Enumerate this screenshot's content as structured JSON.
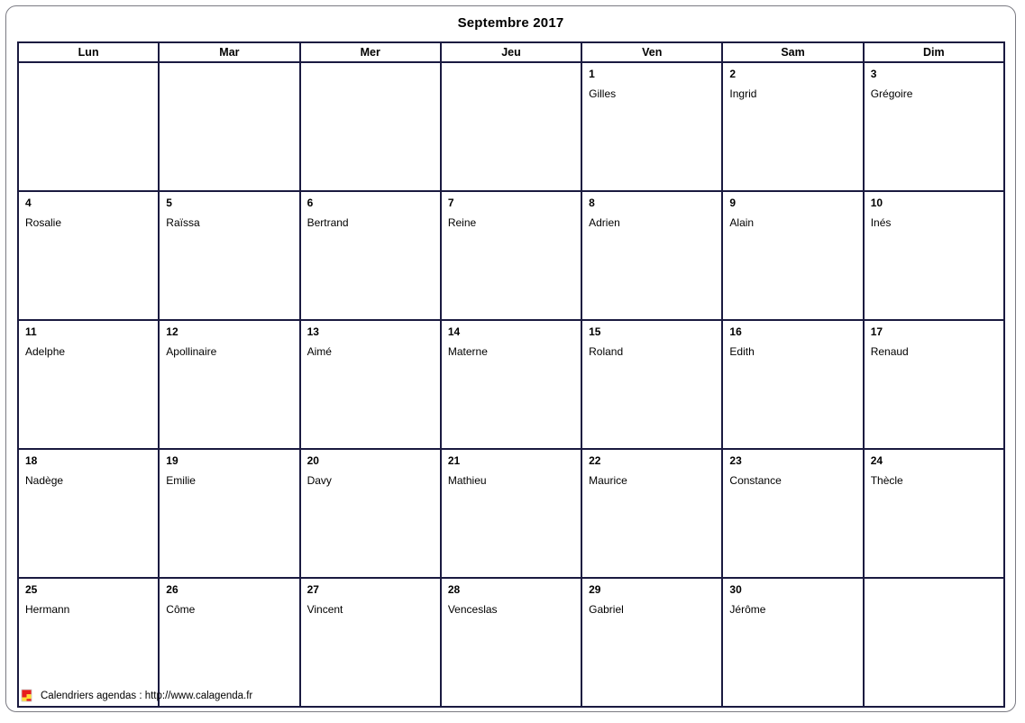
{
  "title": "Septembre 2017",
  "weekday_headers": [
    "Lun",
    "Mar",
    "Mer",
    "Jeu",
    "Ven",
    "Sam",
    "Dim"
  ],
  "weeks": [
    [
      {
        "day": "",
        "name": ""
      },
      {
        "day": "",
        "name": ""
      },
      {
        "day": "",
        "name": ""
      },
      {
        "day": "",
        "name": ""
      },
      {
        "day": "1",
        "name": "Gilles"
      },
      {
        "day": "2",
        "name": "Ingrid"
      },
      {
        "day": "3",
        "name": "Grégoire"
      }
    ],
    [
      {
        "day": "4",
        "name": "Rosalie"
      },
      {
        "day": "5",
        "name": "Raïssa"
      },
      {
        "day": "6",
        "name": "Bertrand"
      },
      {
        "day": "7",
        "name": "Reine"
      },
      {
        "day": "8",
        "name": "Adrien"
      },
      {
        "day": "9",
        "name": "Alain"
      },
      {
        "day": "10",
        "name": "Inés"
      }
    ],
    [
      {
        "day": "11",
        "name": "Adelphe"
      },
      {
        "day": "12",
        "name": "Apollinaire"
      },
      {
        "day": "13",
        "name": "Aimé"
      },
      {
        "day": "14",
        "name": "Materne"
      },
      {
        "day": "15",
        "name": "Roland"
      },
      {
        "day": "16",
        "name": "Edith"
      },
      {
        "day": "17",
        "name": "Renaud"
      }
    ],
    [
      {
        "day": "18",
        "name": "Nadège"
      },
      {
        "day": "19",
        "name": "Emilie"
      },
      {
        "day": "20",
        "name": "Davy"
      },
      {
        "day": "21",
        "name": "Mathieu"
      },
      {
        "day": "22",
        "name": "Maurice"
      },
      {
        "day": "23",
        "name": "Constance"
      },
      {
        "day": "24",
        "name": "Thècle"
      }
    ],
    [
      {
        "day": "25",
        "name": "Hermann"
      },
      {
        "day": "26",
        "name": "Côme"
      },
      {
        "day": "27",
        "name": "Vincent"
      },
      {
        "day": "28",
        "name": "Venceslas"
      },
      {
        "day": "29",
        "name": "Gabriel"
      },
      {
        "day": "30",
        "name": "Jérôme"
      },
      {
        "day": "",
        "name": ""
      }
    ]
  ],
  "footer": {
    "logo_icon": "calagenda-flag-icon",
    "text": "Calendriers agendas : http://www.calagenda.fr"
  },
  "colors": {
    "grid_border": "#1a1a40",
    "frame_border": "#7a7a82",
    "background": "#ffffff",
    "text": "#000000",
    "logo_red": "#e81c1c",
    "logo_yellow": "#ffdd33"
  }
}
